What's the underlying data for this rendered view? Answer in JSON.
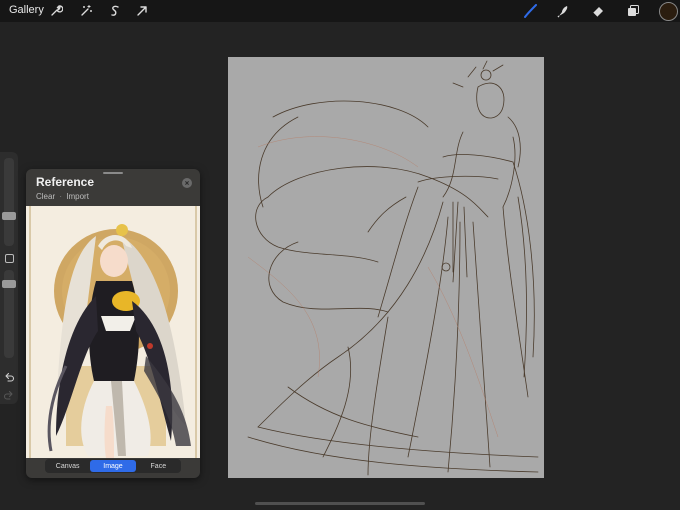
{
  "toolbar": {
    "gallery_label": "Gallery",
    "left_tools": [
      "wrench-icon",
      "magic-wand-icon",
      "selection-icon",
      "transform-icon"
    ],
    "right_tools": [
      "brush-icon",
      "smudge-icon",
      "eraser-icon",
      "layers-icon",
      "color-swatch"
    ],
    "active_tool_color": "#2f6be8",
    "current_color": "#2b1d0f"
  },
  "reference": {
    "title": "Reference",
    "actions": [
      "Clear",
      "Import"
    ],
    "tabs": [
      "Canvas",
      "Image",
      "Face"
    ],
    "active_tab": "Image"
  },
  "colors": {
    "background": "#232323",
    "canvas": "#a9a9a9",
    "sketch_line": "#4a3b2c",
    "accent": "#2f6be8"
  }
}
